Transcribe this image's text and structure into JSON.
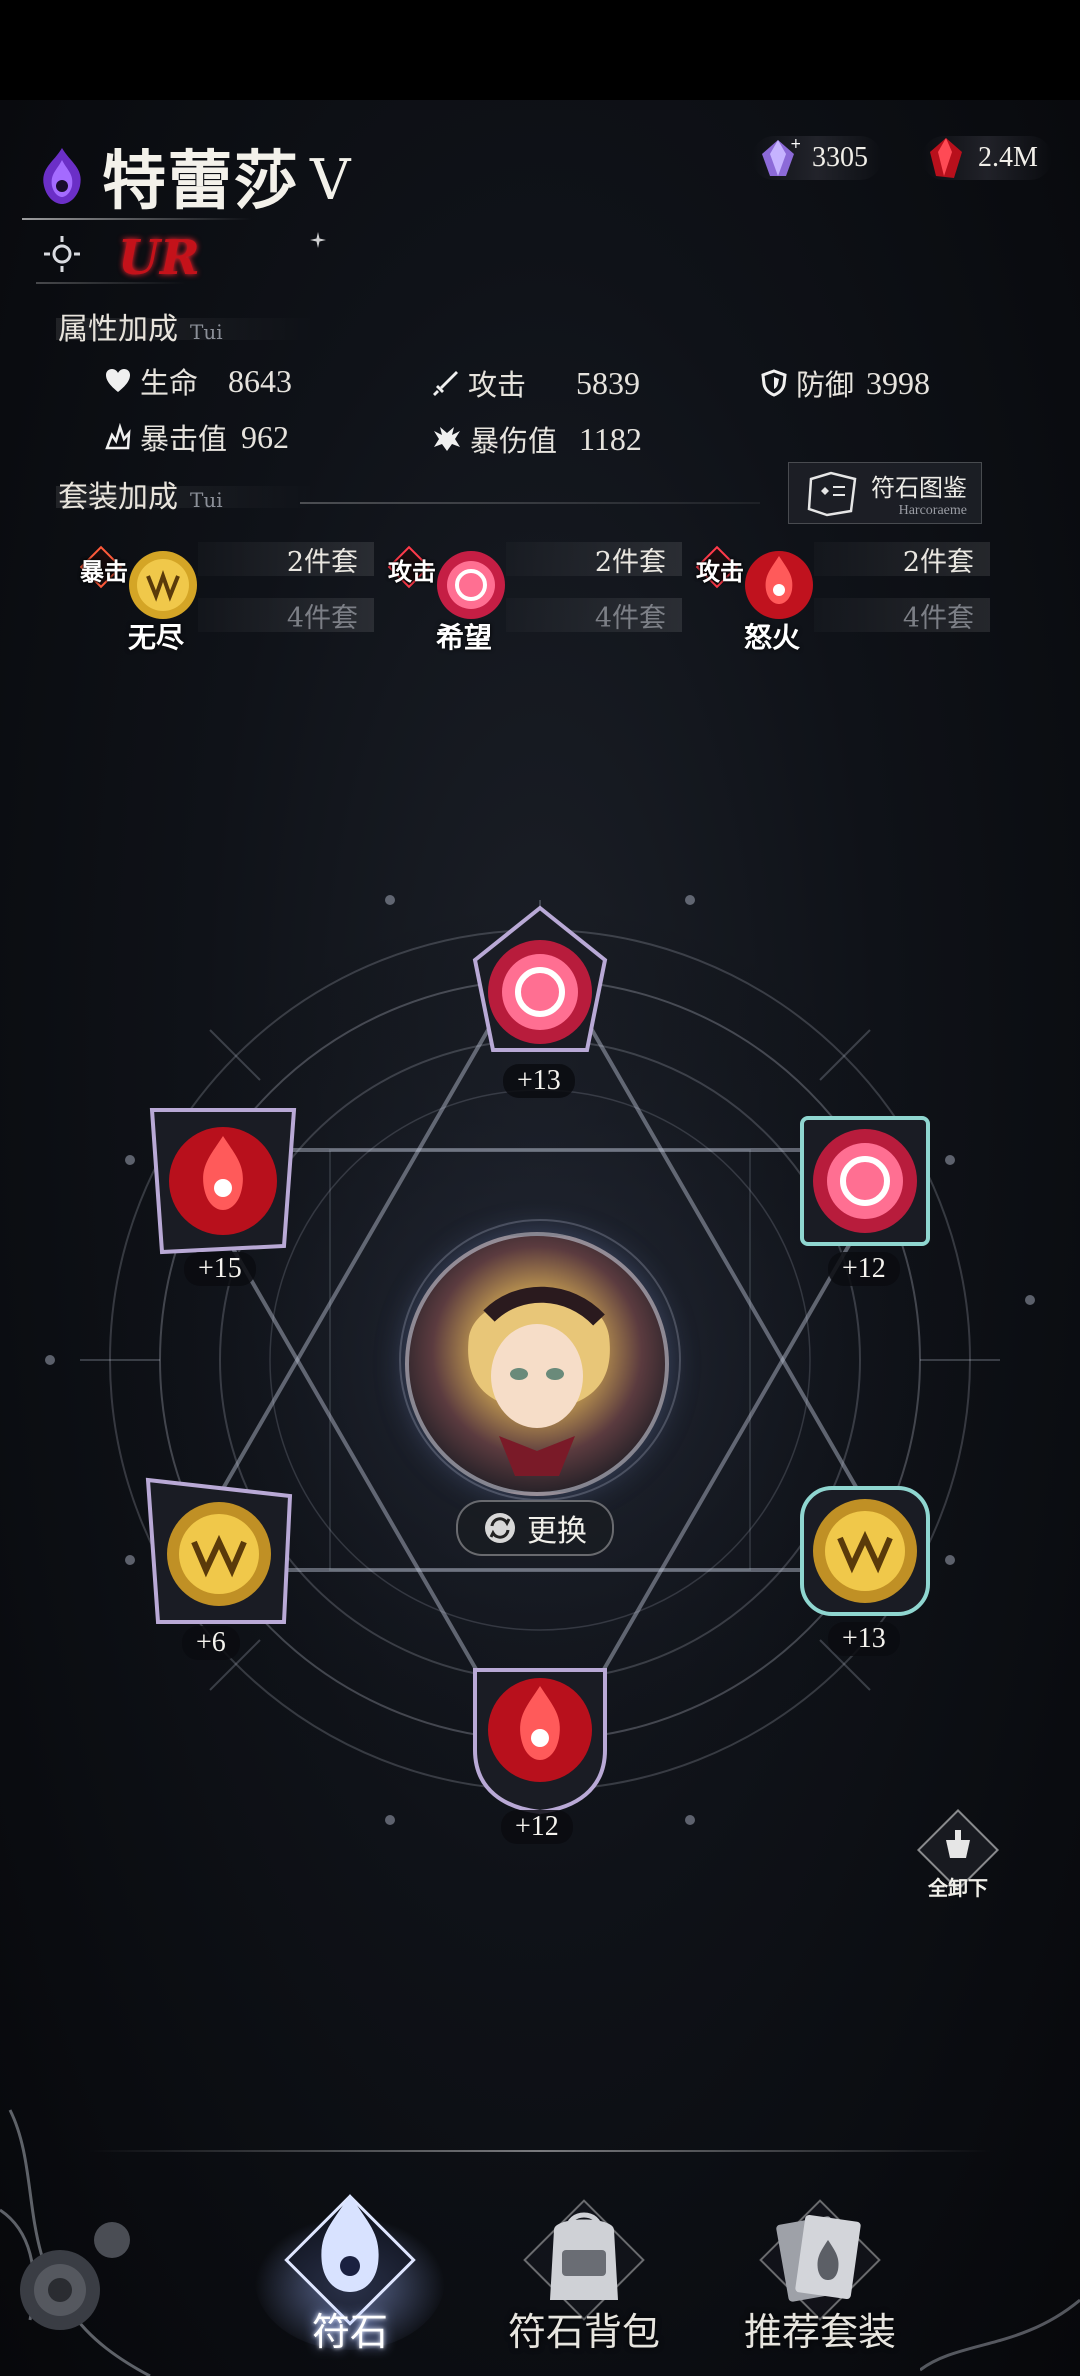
{
  "header": {
    "character_name": "特蕾莎",
    "rank": "V",
    "rarity": "UR",
    "faction_icon": "purple-flame-emblem-icon"
  },
  "currency": {
    "crystal": {
      "icon": "purple-crystal-icon",
      "value": "3305"
    },
    "ruby": {
      "icon": "red-gem-icon",
      "value": "2.4M"
    }
  },
  "attributes": {
    "title": "属性加成",
    "subtitle": "Tui",
    "stats": [
      {
        "icon": "heart-icon",
        "label": "生命",
        "value": "8643"
      },
      {
        "icon": "sword-icon",
        "label": "攻击",
        "value": "5839"
      },
      {
        "icon": "shield-icon",
        "label": "防御",
        "value": "3998"
      },
      {
        "icon": "crit-icon",
        "label": "暴击值",
        "value": "962"
      },
      {
        "icon": "crit-damage-icon",
        "label": "暴伤值",
        "value": "1182"
      }
    ]
  },
  "set_bonus": {
    "title": "套装加成",
    "subtitle": "Tui",
    "codex_button": {
      "label": "符石图鉴",
      "sublabel": "Harcoraeme"
    },
    "sets": [
      {
        "tag": "暴击",
        "name": "无尽",
        "two_piece": "2件套",
        "four_piece": "4件套",
        "color": "#d4a526"
      },
      {
        "tag": "攻击",
        "name": "希望",
        "two_piece": "2件套",
        "four_piece": "4件套",
        "color": "#e8355e"
      },
      {
        "tag": "攻击",
        "name": "怒火",
        "two_piece": "2件套",
        "four_piece": "4件套",
        "color": "#e02a3c"
      }
    ]
  },
  "slots": [
    {
      "level": "+13",
      "rune": "hope-rune-icon",
      "color": "#e8355e"
    },
    {
      "level": "+12",
      "rune": "hope-rune-icon",
      "color": "#e8355e"
    },
    {
      "level": "+13",
      "rune": "endless-rune-icon",
      "color": "#d4a526"
    },
    {
      "level": "+12",
      "rune": "fury-rune-icon",
      "color": "#e02a3c"
    },
    {
      "level": "+6",
      "rune": "endless-rune-icon",
      "color": "#d4a526"
    },
    {
      "level": "+15",
      "rune": "fury-rune-icon",
      "color": "#e02a3c"
    }
  ],
  "center": {
    "portrait": "character-portrait",
    "swap_label": "更换"
  },
  "unequip_all": {
    "label": "全卸下"
  },
  "bottom_nav": [
    {
      "label": "符石",
      "active": true
    },
    {
      "label": "符石背包",
      "active": false
    },
    {
      "label": "推荐套装",
      "active": false
    }
  ]
}
